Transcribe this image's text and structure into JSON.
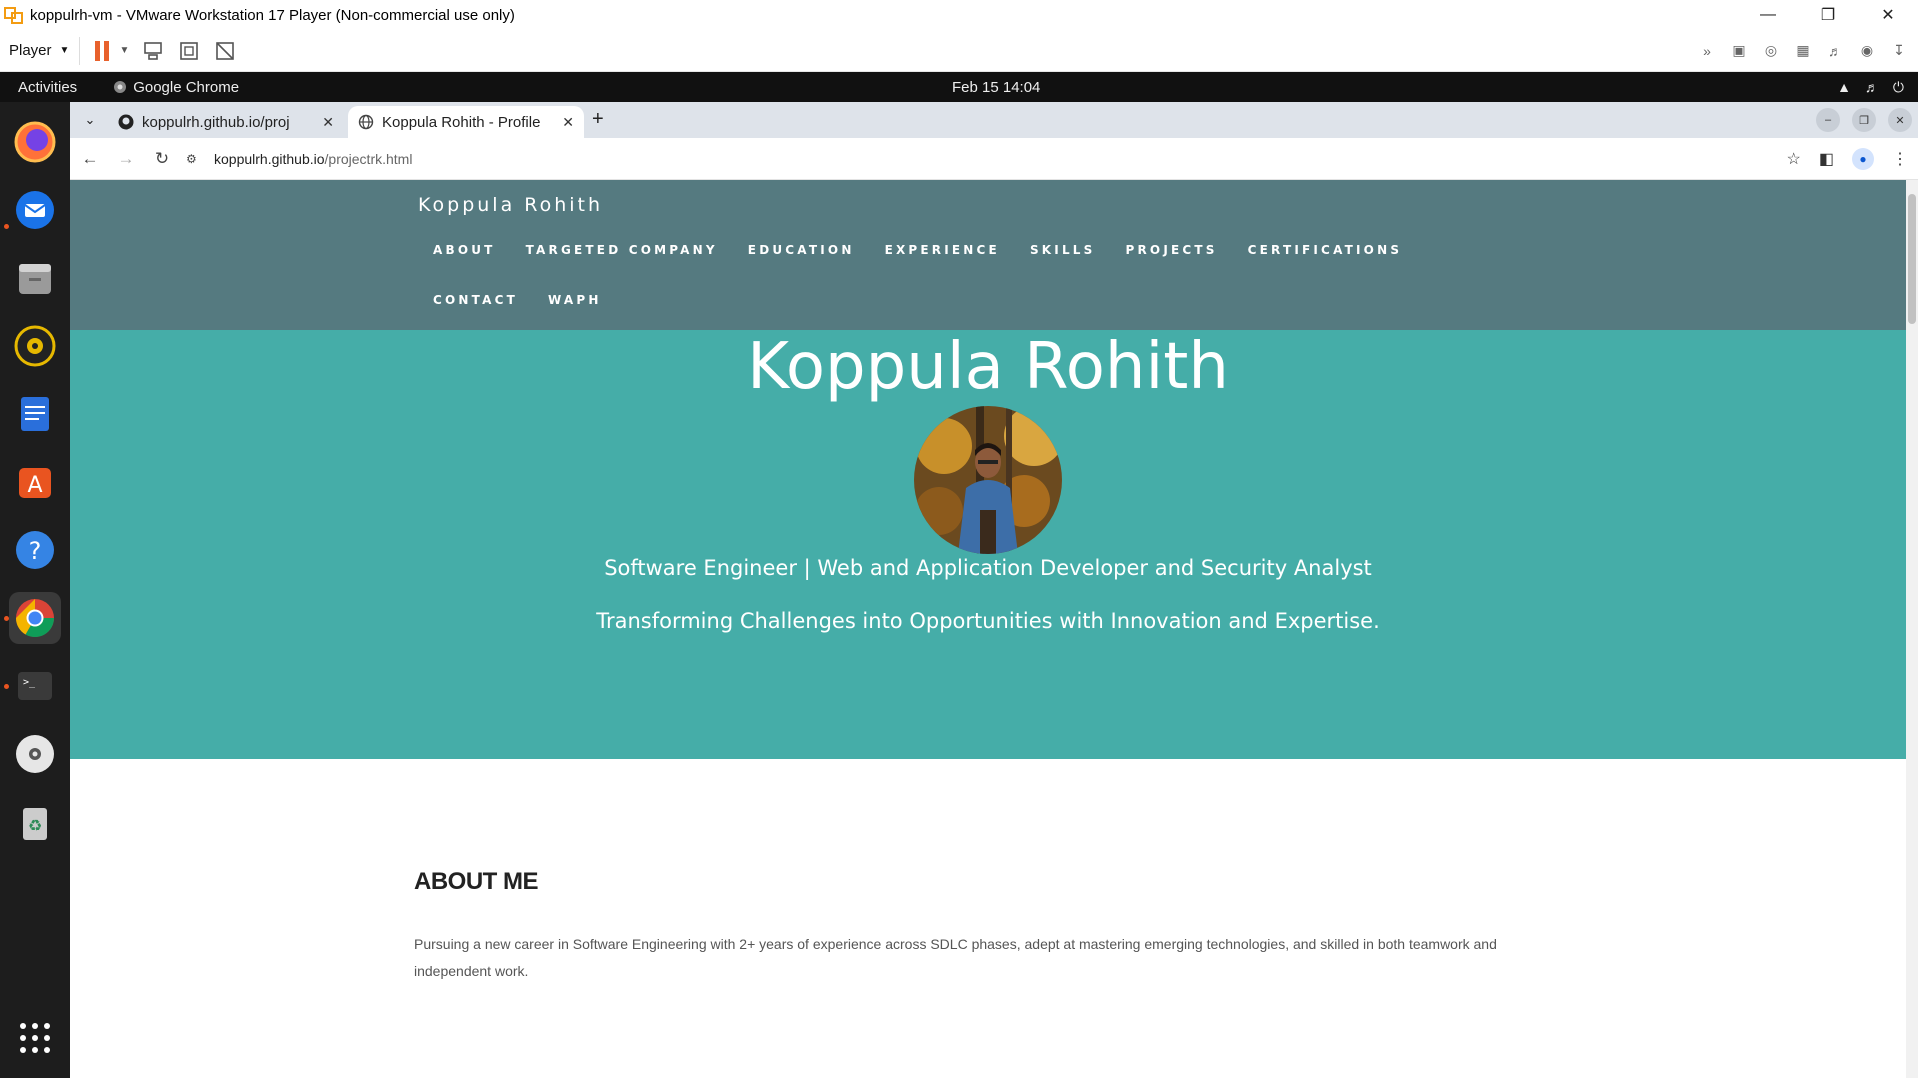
{
  "vmware": {
    "title": "koppulrh-vm - VMware Workstation 17 Player (Non-commercial use only)",
    "player_menu": "Player"
  },
  "gnome": {
    "activities": "Activities",
    "app_name": "Google Chrome",
    "clock": "Feb 15  14:04"
  },
  "chrome": {
    "tabs": [
      {
        "title": "koppulrh.github.io/proj",
        "icon": "github-icon",
        "active": false
      },
      {
        "title": "Koppula Rohith - Profile",
        "icon": "globe-icon",
        "active": true
      }
    ],
    "url_host": "koppulrh.github.io",
    "url_path": "/projectrk.html"
  },
  "site": {
    "brand": "Koppula Rohith",
    "nav": [
      "ABOUT",
      "TARGETED COMPANY",
      "EDUCATION",
      "EXPERIENCE",
      "SKILLS",
      "PROJECTS",
      "CERTIFICATIONS",
      "CONTACT",
      "WAPH"
    ],
    "hero": {
      "name": "Koppula Rohith",
      "role": "Software Engineer | Web and Application Developer and Security Analyst",
      "tagline": "Transforming Challenges into Opportunities with Innovation and Expertise."
    },
    "about": {
      "title": "ABOUT ME",
      "text": "Pursuing a new career in Software Engineering with 2+ years of experience across SDLC phases, adept at mastering emerging technologies, and skilled in both teamwork and independent work."
    }
  },
  "colors": {
    "nav_bg": "#557a80",
    "hero_bg": "#45ada8",
    "dock_bg": "#1d1d1d",
    "topbar_bg": "#111111"
  }
}
